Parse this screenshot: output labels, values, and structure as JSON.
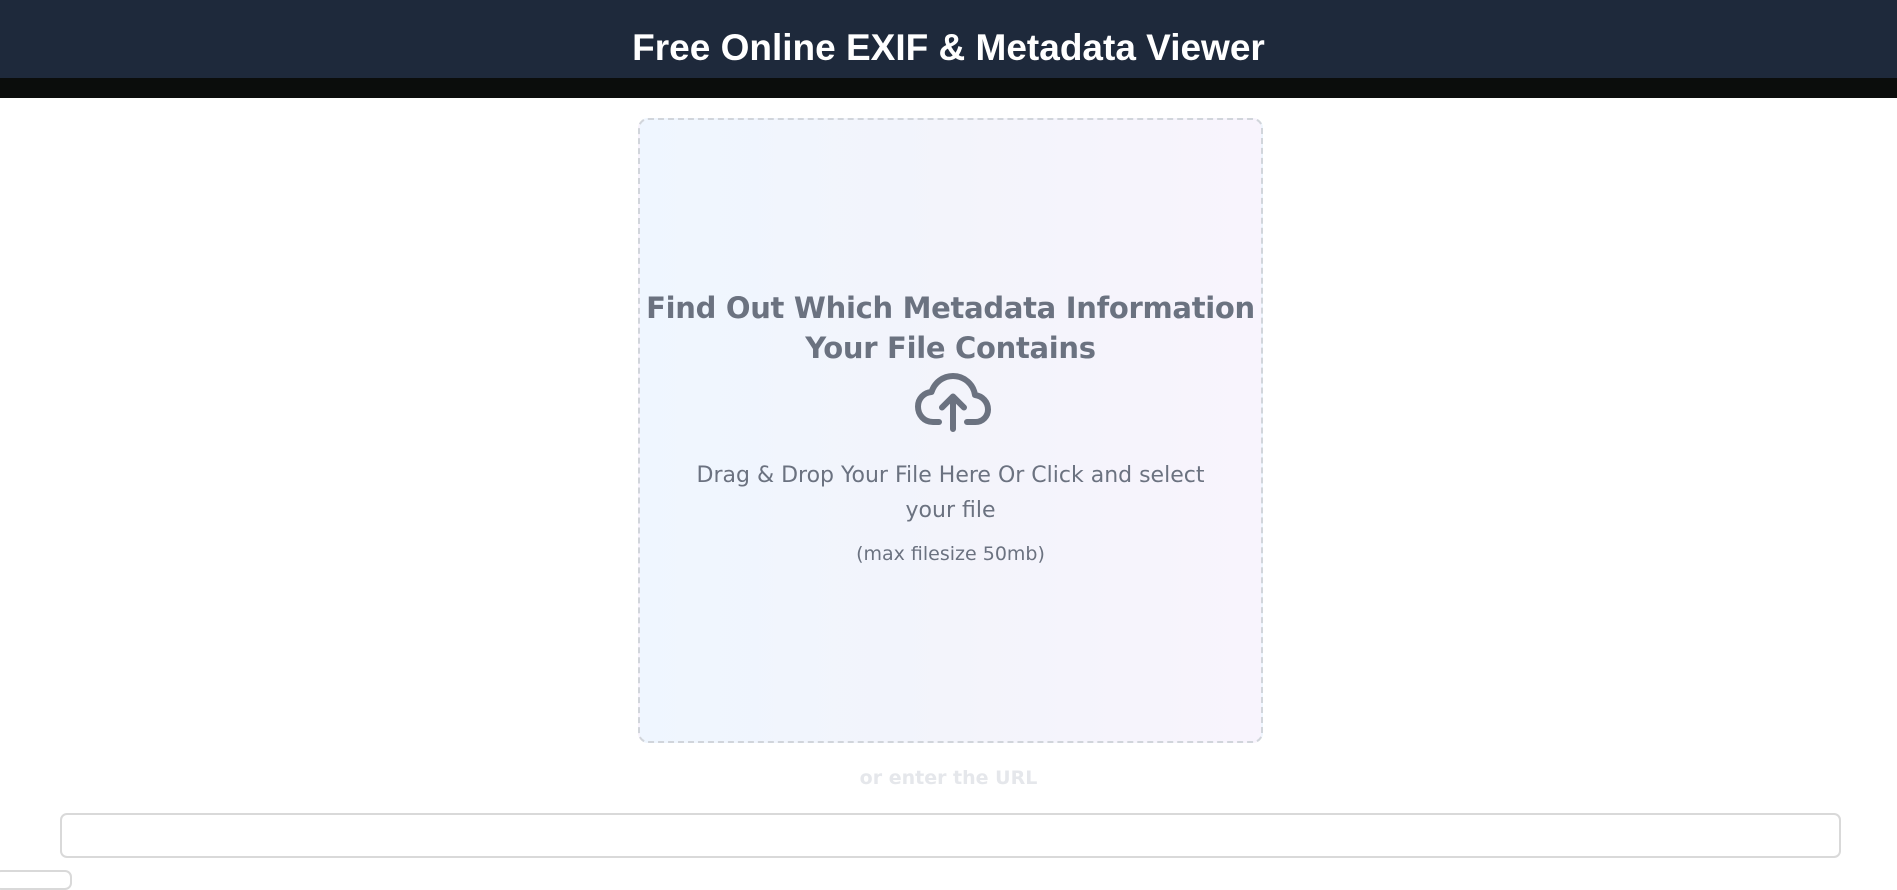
{
  "header": {
    "title": "Free Online EXIF & Metadata Viewer"
  },
  "dropzone": {
    "heading": "Find Out Which Metadata Information Your File Contains",
    "icon": "cloud-upload-icon",
    "instructions": "Drag & Drop Your File Here Or Click and select your file",
    "limit": "(max filesize 50mb)"
  },
  "url_section": {
    "divider_label": "or enter the URL",
    "input_value": "",
    "input_placeholder": ""
  },
  "colors": {
    "header_bg": "#1e293b",
    "header_border": "#0b0d0c",
    "text_muted": "#6b7280",
    "dropzone_border": "#d1d5db"
  }
}
